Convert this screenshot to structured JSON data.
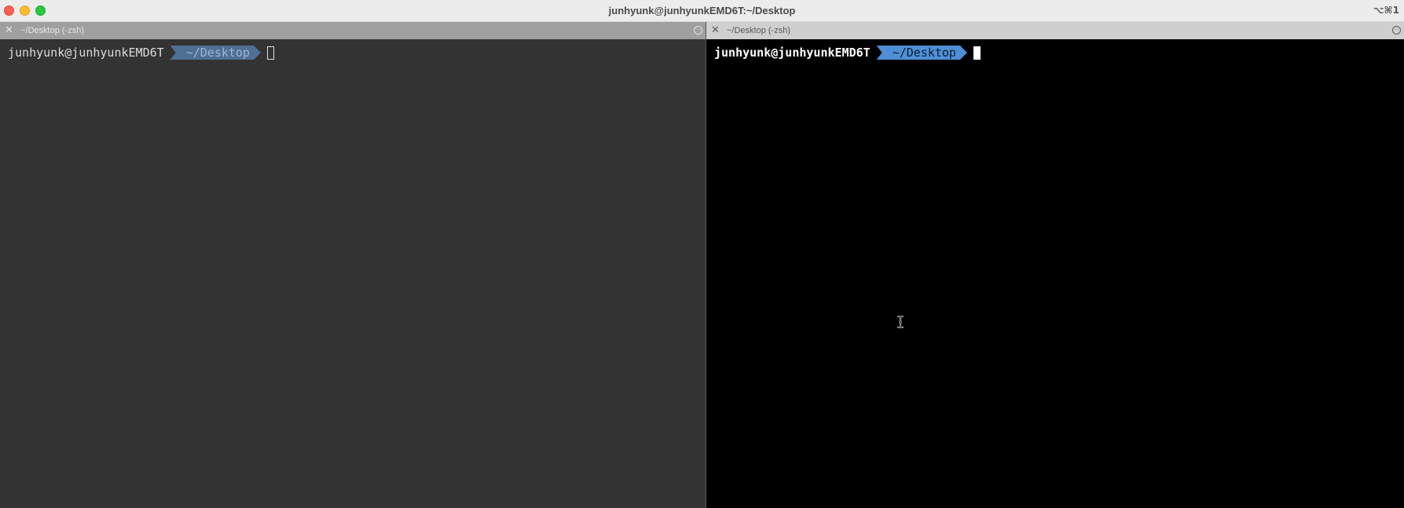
{
  "window": {
    "title": "junhyunk@junhyunkEMD6T:~/Desktop",
    "shortcut": "⌥⌘1"
  },
  "panes": {
    "left": {
      "tab_title": "~/Desktop (-zsh)",
      "user_host": "junhyunk@junhyunkEMD6T",
      "directory": "~/Desktop",
      "active": false
    },
    "right": {
      "tab_title": "~/Desktop (-zsh)",
      "user_host": "junhyunk@junhyunkEMD6T",
      "directory": "~/Desktop",
      "active": true
    }
  },
  "icons": {
    "tab_close": "close-icon",
    "tab_menu": "more-icon",
    "mouse_cursor": "text-cursor-icon"
  },
  "colors": {
    "left_background": "#333333",
    "right_background": "#000000",
    "prompt_segment": "#4e8fd6"
  }
}
